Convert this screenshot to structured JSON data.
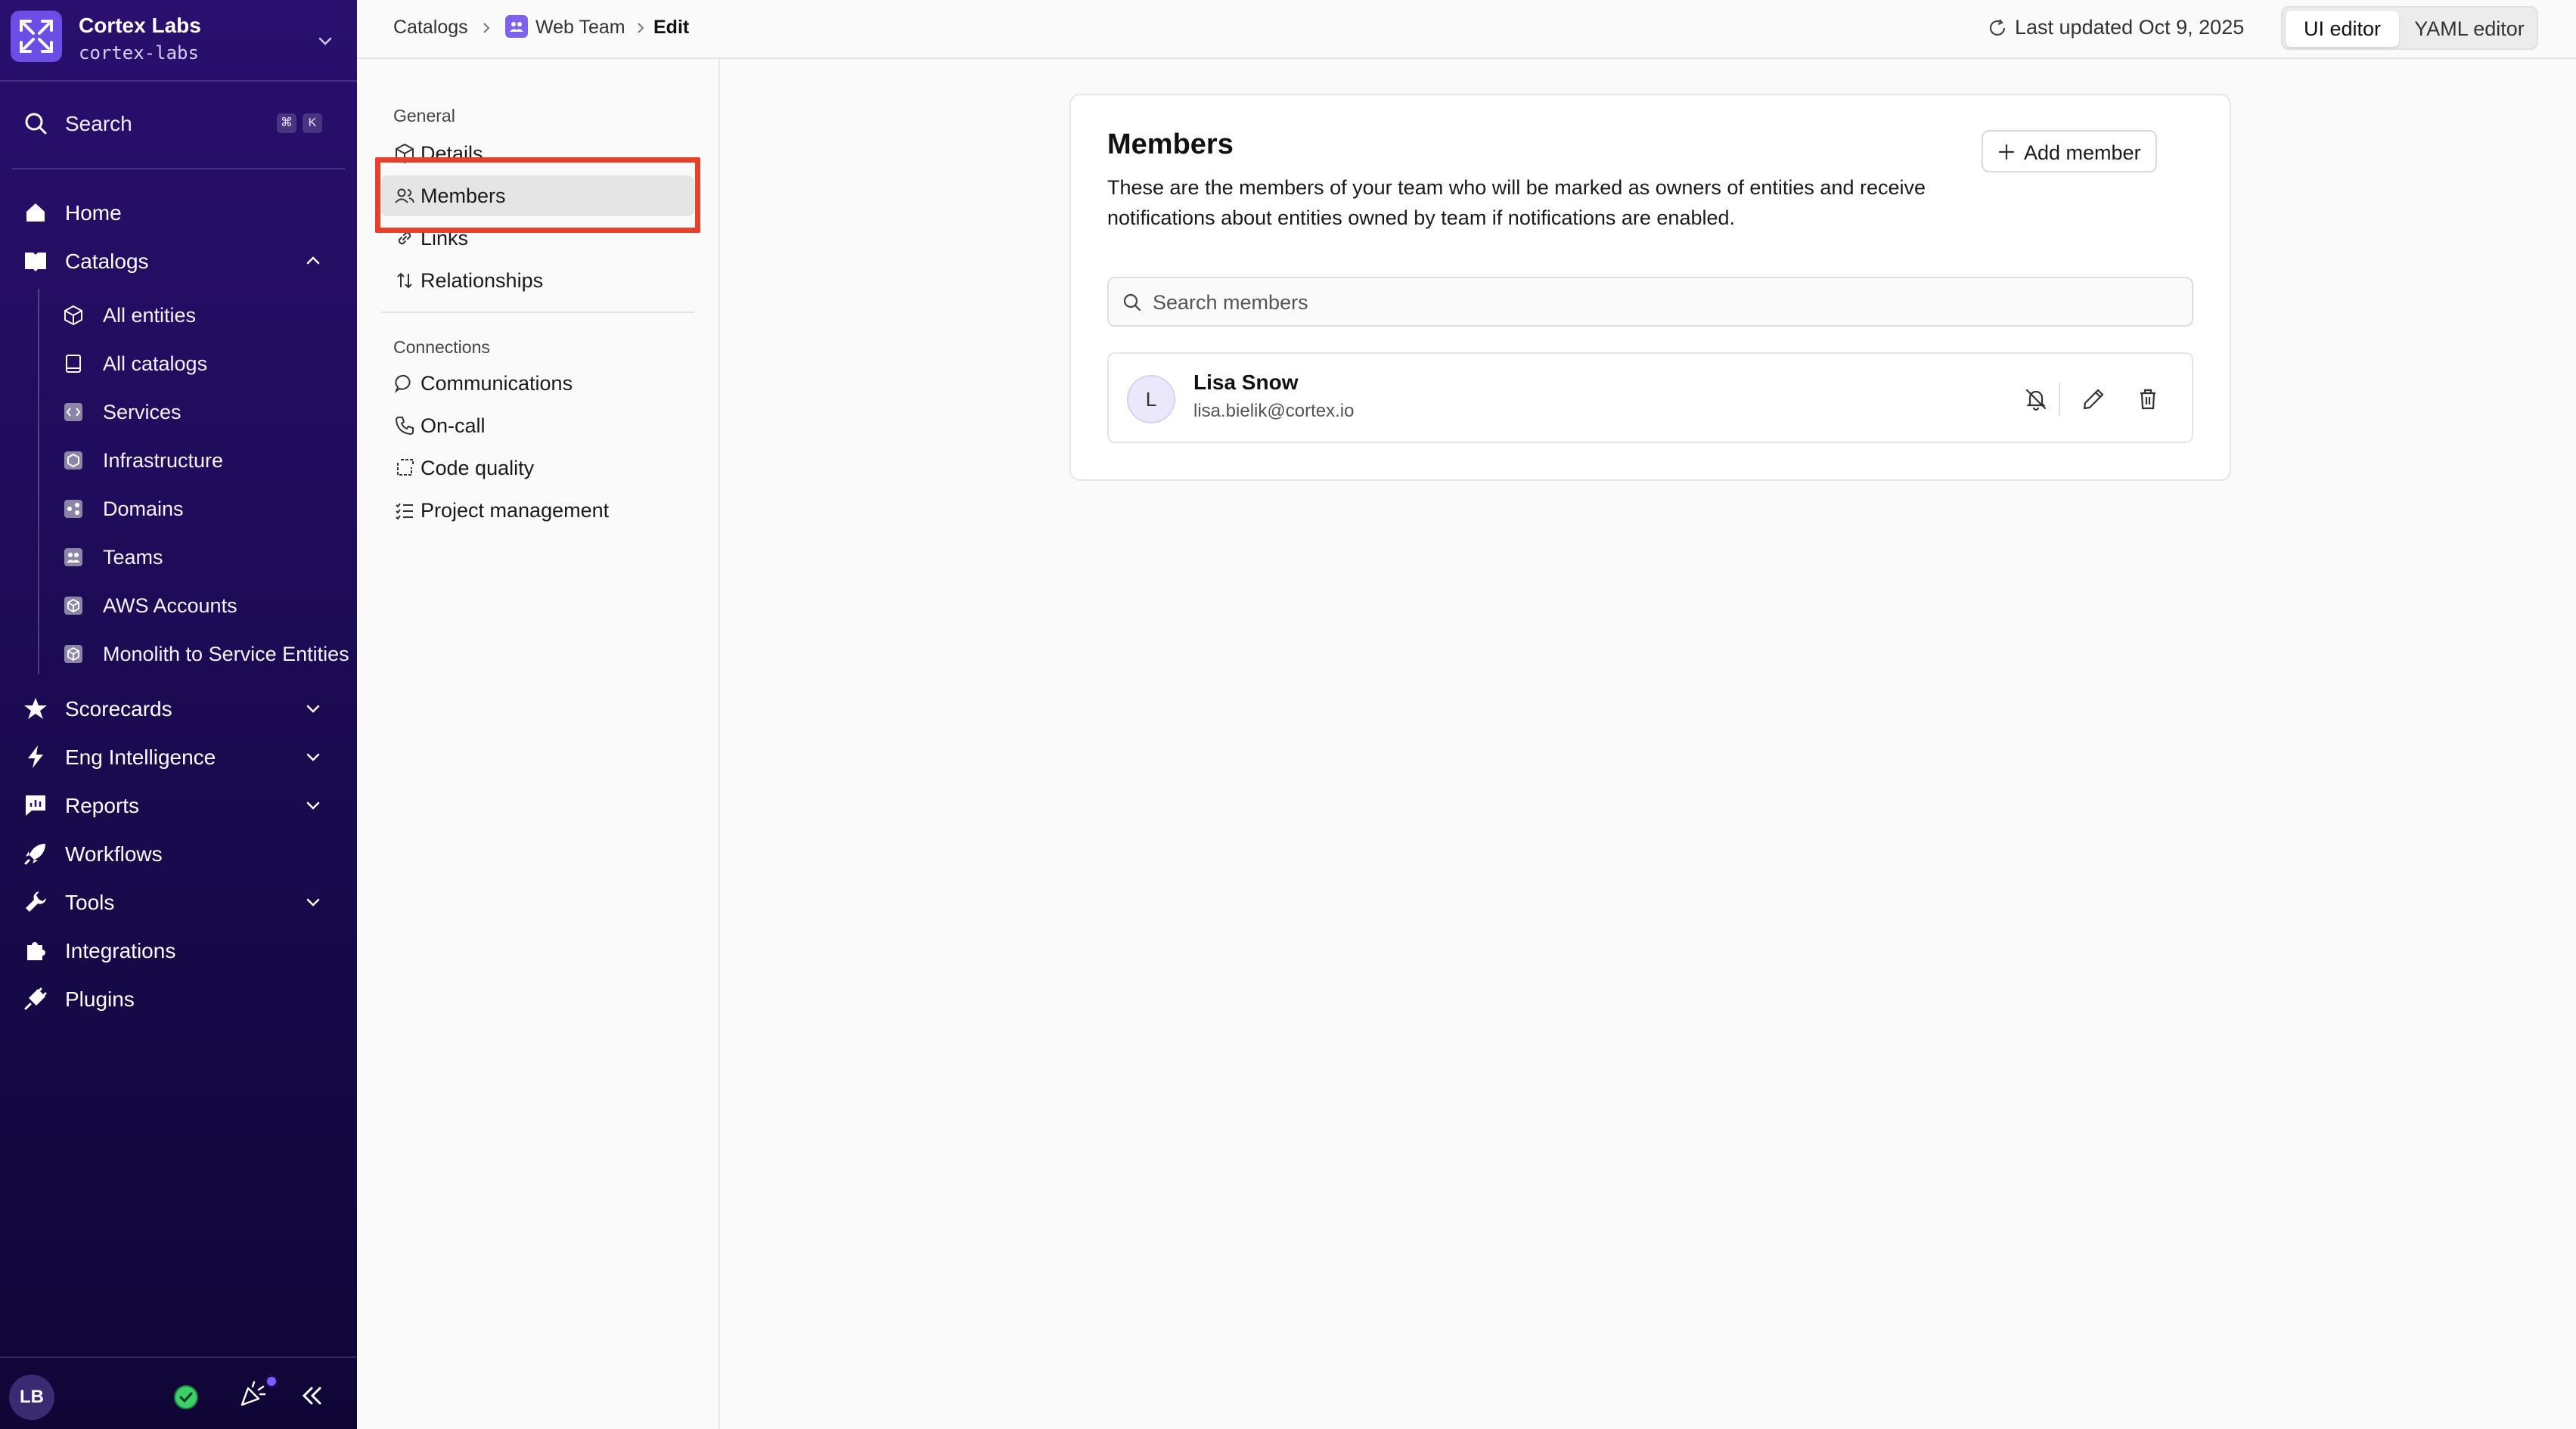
{
  "org": {
    "name": "Cortex Labs",
    "slug": "cortex-labs"
  },
  "search": {
    "label": "Search",
    "shortcut_mod": "⌘",
    "shortcut_key": "K"
  },
  "nav": {
    "home": "Home",
    "catalogs": "Catalogs",
    "catalog_items": [
      "All entities",
      "All catalogs",
      "Services",
      "Infrastructure",
      "Domains",
      "Teams",
      "AWS Accounts",
      "Monolith to Service Entities"
    ],
    "scorecards": "Scorecards",
    "eng_intelligence": "Eng Intelligence",
    "reports": "Reports",
    "workflows": "Workflows",
    "tools": "Tools",
    "integrations": "Integrations",
    "plugins": "Plugins"
  },
  "footer": {
    "user_initials": "LB"
  },
  "breadcrumb": {
    "root": "Catalogs",
    "team": "Web Team",
    "current": "Edit"
  },
  "topbar": {
    "last_updated": "Last updated Oct 9, 2025",
    "ui_editor": "UI editor",
    "yaml_editor": "YAML editor"
  },
  "subnav": {
    "general_heading": "General",
    "details": "Details",
    "members": "Members",
    "links": "Links",
    "relationships": "Relationships",
    "connections_heading": "Connections",
    "communications": "Communications",
    "on_call": "On-call",
    "code_quality": "Code quality",
    "project_management": "Project management"
  },
  "members_card": {
    "title": "Members",
    "description": "These are the members of your team who will be marked as owners of entities and receive notifications about entities owned by team if notifications are enabled.",
    "add_button": "Add member",
    "search_placeholder": "Search members",
    "members": [
      {
        "initial": "L",
        "name": "Lisa Snow",
        "email": "lisa.bielik@cortex.io"
      }
    ]
  },
  "colors": {
    "accent": "#6b4ee6",
    "highlight": "#e8402a",
    "sidebar_top": "#2a0f6e",
    "sidebar_bottom": "#0f0636"
  }
}
